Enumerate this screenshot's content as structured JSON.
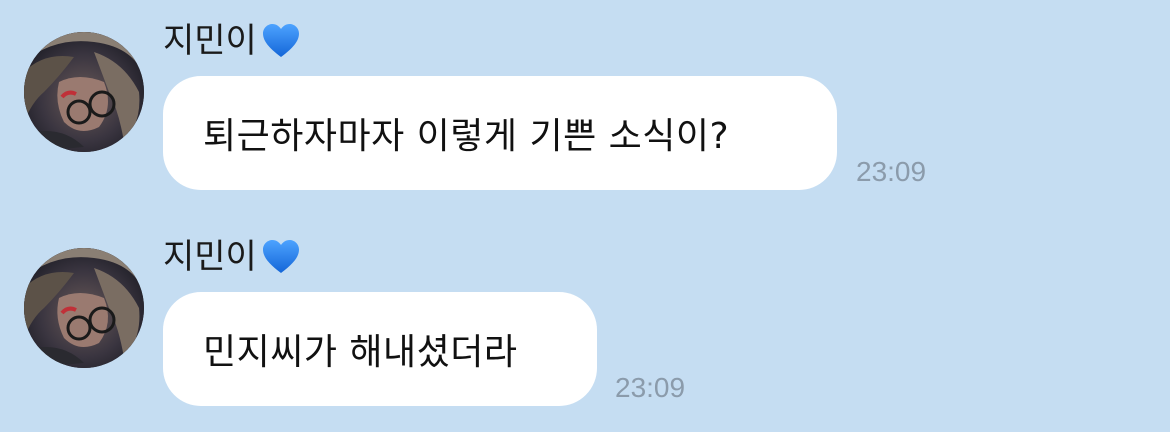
{
  "colors": {
    "background": "#c5ddf2",
    "bubble": "#ffffff",
    "timestamp": "#8b9bab",
    "heart": "#1e7ef0"
  },
  "messages": [
    {
      "sender": "지민이",
      "sender_icon": "blue-heart-icon",
      "text": "퇴근하자마자 이렇게 기쁜 소식이?",
      "time": "23:09"
    },
    {
      "sender": "지민이",
      "sender_icon": "blue-heart-icon",
      "text": "민지씨가 해내셨더라",
      "time": "23:09"
    }
  ]
}
